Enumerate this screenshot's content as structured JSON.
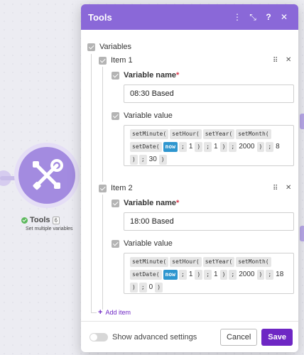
{
  "modal": {
    "title": "Tools",
    "header_icons": [
      "kebab-icon",
      "expand-icon",
      "help-icon",
      "close-icon"
    ],
    "header_color": "#8a68d8"
  },
  "node": {
    "title": "Tools",
    "badge": "6",
    "subtitle": "Set multiple variables",
    "color": "#a38be0"
  },
  "variables_label": "Variables",
  "items": [
    {
      "label": "Item 1",
      "name_label": "Variable name",
      "name_value": "08:30 Based",
      "value_label": "Variable value",
      "tokens": [
        {
          "t": "setMinute(",
          "k": "fn"
        },
        {
          "t": "setHour(",
          "k": "fn"
        },
        {
          "t": "setYear(",
          "k": "fn"
        },
        {
          "t": "setMonth(",
          "k": "fn"
        },
        {
          "t": "setDate(",
          "k": "fn"
        },
        {
          "t": "now",
          "k": "var"
        },
        {
          "t": ";",
          "k": "fn"
        },
        {
          "t": "1",
          "k": "num"
        },
        {
          "t": ")",
          "k": "fn"
        },
        {
          "t": ";",
          "k": "fn"
        },
        {
          "t": "1",
          "k": "num"
        },
        {
          "t": ")",
          "k": "fn"
        },
        {
          "t": ";",
          "k": "fn"
        },
        {
          "t": "2000",
          "k": "num"
        },
        {
          "t": ")",
          "k": "fn"
        },
        {
          "t": ";",
          "k": "fn"
        },
        {
          "t": "8",
          "k": "num"
        },
        {
          "t": ")",
          "k": "fn"
        },
        {
          "t": ";",
          "k": "fn"
        },
        {
          "t": "30",
          "k": "num"
        },
        {
          "t": ")",
          "k": "fn"
        }
      ]
    },
    {
      "label": "Item 2",
      "name_label": "Variable name",
      "name_value": "18:00 Based",
      "value_label": "Variable value",
      "tokens": [
        {
          "t": "setMinute(",
          "k": "fn"
        },
        {
          "t": "setHour(",
          "k": "fn"
        },
        {
          "t": "setYear(",
          "k": "fn"
        },
        {
          "t": "setMonth(",
          "k": "fn"
        },
        {
          "t": "setDate(",
          "k": "fn"
        },
        {
          "t": "now",
          "k": "var"
        },
        {
          "t": ";",
          "k": "fn"
        },
        {
          "t": "1",
          "k": "num"
        },
        {
          "t": ")",
          "k": "fn"
        },
        {
          "t": ";",
          "k": "fn"
        },
        {
          "t": "1",
          "k": "num"
        },
        {
          "t": ")",
          "k": "fn"
        },
        {
          "t": ";",
          "k": "fn"
        },
        {
          "t": "2000",
          "k": "num"
        },
        {
          "t": ")",
          "k": "fn"
        },
        {
          "t": ";",
          "k": "fn"
        },
        {
          "t": "18",
          "k": "num"
        },
        {
          "t": ")",
          "k": "fn"
        },
        {
          "t": ";",
          "k": "fn"
        },
        {
          "t": "0",
          "k": "num"
        },
        {
          "t": ")",
          "k": "fn"
        }
      ]
    }
  ],
  "add_item_label": "Add item",
  "footer": {
    "advanced_label": "Show advanced settings",
    "cancel_label": "Cancel",
    "save_label": "Save",
    "save_color": "#6e27c4"
  }
}
